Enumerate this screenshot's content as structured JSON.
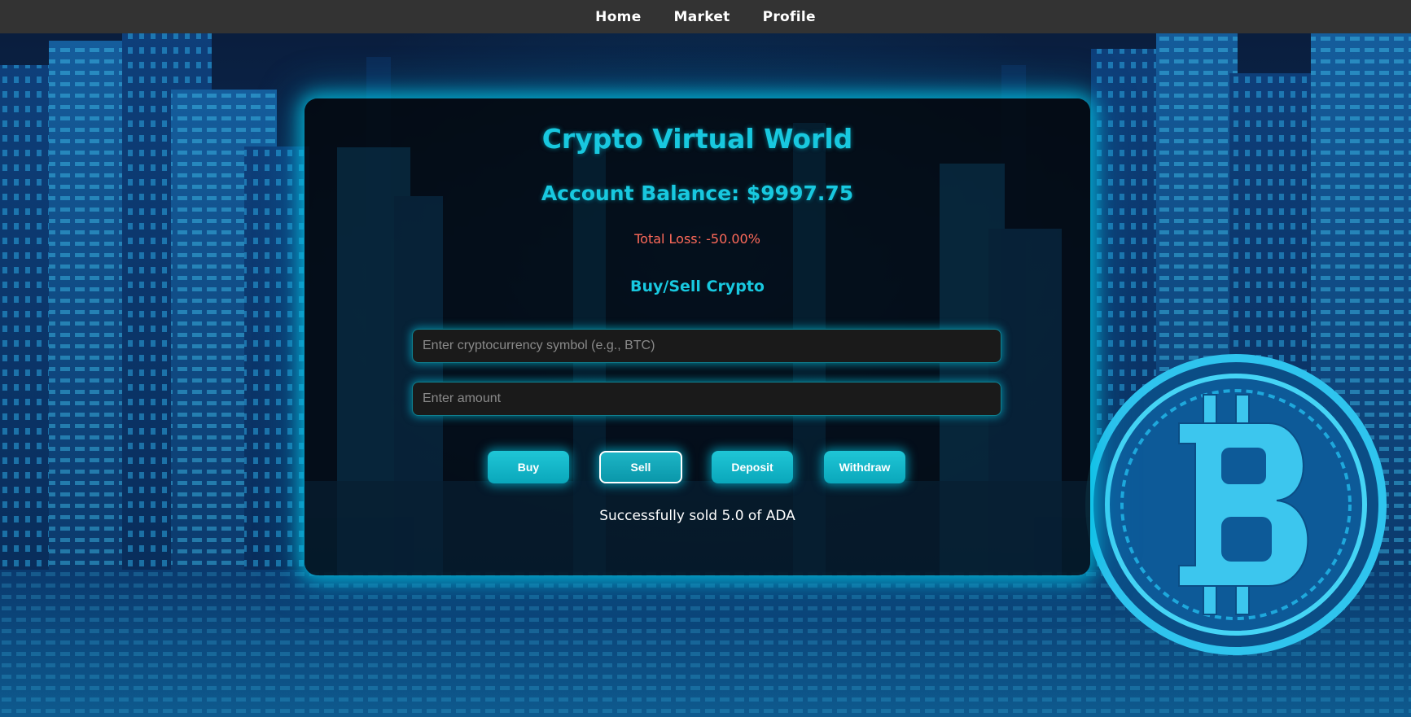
{
  "nav": {
    "items": [
      {
        "label": "Home"
      },
      {
        "label": "Market"
      },
      {
        "label": "Profile"
      }
    ]
  },
  "card": {
    "title": "Crypto Virtual World",
    "balance": "Account Balance: $9997.75",
    "loss": "Total Loss: -50.00%",
    "section_title": "Buy/Sell Crypto",
    "symbol_input": {
      "placeholder": "Enter cryptocurrency symbol (e.g., BTC)",
      "value": ""
    },
    "amount_input": {
      "placeholder": "Enter amount",
      "value": ""
    },
    "buttons": {
      "buy": "Buy",
      "sell": "Sell",
      "deposit": "Deposit",
      "withdraw": "Withdraw"
    },
    "message": "Successfully sold 5.0 of ADA"
  },
  "colors": {
    "accent": "#18c8df",
    "loss": "#ff6a5a",
    "nav_bg": "#333333",
    "card_bg": "#03080e",
    "button": "#1fc6d6"
  },
  "icons": {
    "coin": "bitcoin-icon"
  }
}
